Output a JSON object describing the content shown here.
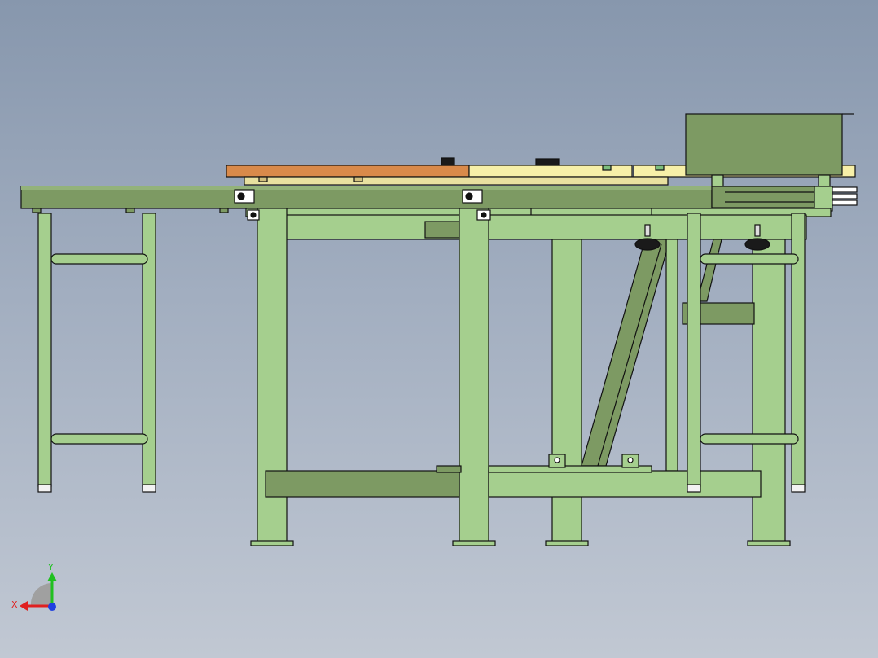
{
  "viewport": {
    "background_top": "#8797ad",
    "background_bottom": "#c1c8d3"
  },
  "colors": {
    "frame": "#a5cf8e",
    "frame_shadow": "#7a9c62",
    "frame_dark": "#6f8f5a",
    "outline": "#111111",
    "wood_top": "#d98a4a",
    "cream_plate": "#f7f0a8",
    "knob": "#1a1a1a",
    "foot_cap": "#f2f2f2"
  },
  "triad": {
    "x_label": "X",
    "y_label": "Y",
    "x_color": "#e02020",
    "y_color": "#20c020",
    "z_color": "#2040e0"
  }
}
